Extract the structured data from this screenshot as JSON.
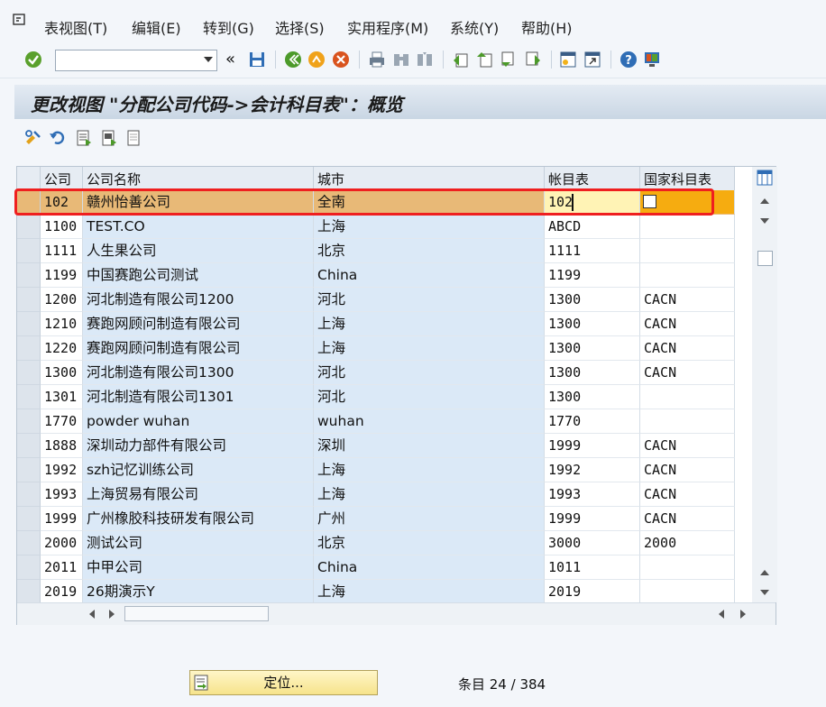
{
  "menu": [
    "表视图(T)",
    "编辑(E)",
    "转到(G)",
    "选择(S)",
    "实用程序(M)",
    "系统(Y)",
    "帮助(H)"
  ],
  "title": "更改视图 \"分配公司代码->会计科目表\"：概览",
  "table": {
    "columns": [
      "公司",
      "公司名称",
      "城市",
      "帐目表",
      "国家科目表"
    ],
    "rows": [
      [
        "102",
        "赣州怡善公司",
        "全南",
        "102",
        ""
      ],
      [
        "1100",
        "TEST.CO",
        "上海",
        "ABCD",
        ""
      ],
      [
        "1111",
        "人生果公司",
        "北京",
        "1111",
        ""
      ],
      [
        "1199",
        "中国赛跑公司测试",
        "China",
        "1199",
        ""
      ],
      [
        "1200",
        "河北制造有限公司1200",
        "河北",
        "1300",
        "CACN"
      ],
      [
        "1210",
        "赛跑网顾问制造有限公司",
        "上海",
        "1300",
        "CACN"
      ],
      [
        "1220",
        "赛跑网顾问制造有限公司",
        "上海",
        "1300",
        "CACN"
      ],
      [
        "1300",
        "河北制造有限公司1300",
        "河北",
        "1300",
        "CACN"
      ],
      [
        "1301",
        "河北制造有限公司1301",
        "河北",
        "1300",
        ""
      ],
      [
        "1770",
        "powder wuhan",
        "wuhan",
        "1770",
        ""
      ],
      [
        "1888",
        "深圳动力部件有限公司",
        "深圳",
        "1999",
        "CACN"
      ],
      [
        "1992",
        "szh记忆训练公司",
        "上海",
        "1992",
        "CACN"
      ],
      [
        "1993",
        "上海贸易有限公司",
        "上海",
        "1993",
        "CACN"
      ],
      [
        "1999",
        "广州橡胶科技研发有限公司",
        "广州",
        "1999",
        "CACN"
      ],
      [
        "2000",
        "测试公司",
        "北京",
        "3000",
        "2000"
      ],
      [
        "2011",
        "中甲公司",
        "China",
        "1011",
        ""
      ],
      [
        "2019",
        "26期演示Y",
        "上海",
        "2019",
        ""
      ]
    ],
    "selected_row": 0
  },
  "footer": {
    "position_button": "定位...",
    "entry_count": "条目 24 / 384"
  },
  "colors": {
    "selected_row": "#e8b977",
    "highlight_border": "#ef1f1f",
    "cell_blue": "#dbe9f7"
  }
}
